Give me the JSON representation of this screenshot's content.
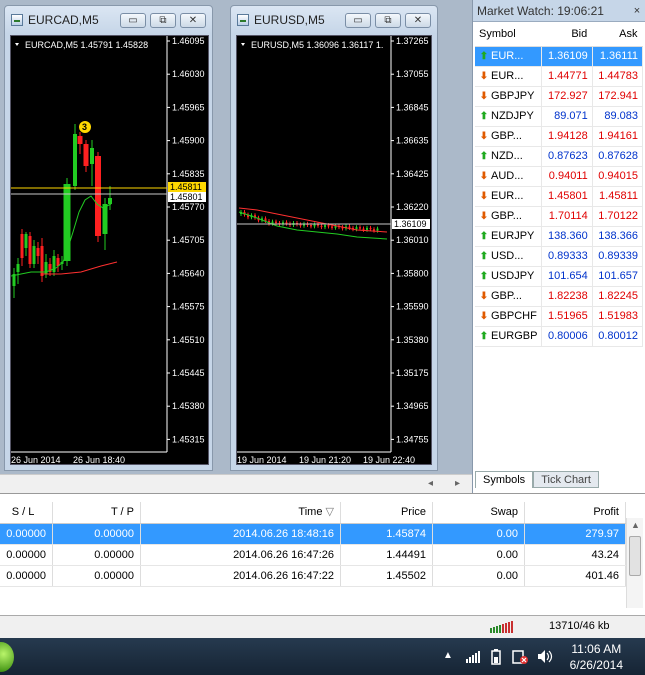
{
  "windows": [
    {
      "title": "EURCAD,M5",
      "chart_header": "EURCAD,M5  1.45791 1.45828",
      "price_labels": [
        "1.46095",
        "1.46030",
        "1.45965",
        "1.45900",
        "1.45835",
        "1.45770",
        "1.45705",
        "1.45640",
        "1.45575",
        "1.45510",
        "1.45445",
        "1.45380",
        "1.45315"
      ],
      "highlight_price": "1.45811",
      "bid_price": "1.45801",
      "time_labels": [
        "26 Jun 2014",
        "26 Jun 18:40"
      ],
      "marker": "3"
    },
    {
      "title": "EURUSD,M5",
      "chart_header": "EURUSD,M5  1.36096 1.36117 1.",
      "price_labels": [
        "1.37265",
        "1.37055",
        "1.36845",
        "1.36635",
        "1.36425",
        "1.36220",
        "1.36010",
        "1.35800",
        "1.35590",
        "1.35380",
        "1.35175",
        "1.34965",
        "1.34755"
      ],
      "bid_price": "1.36109",
      "time_labels": [
        "19 Jun 2014",
        "19 Jun 21:20",
        "19 Jun 22:40"
      ]
    }
  ],
  "window_buttons": {
    "minimize": "▭",
    "restore": "⧉",
    "close": "✕"
  },
  "market_watch": {
    "title": "Market Watch: 19:06:21",
    "close": "×",
    "columns": {
      "symbol": "Symbol",
      "bid": "Bid",
      "ask": "Ask"
    },
    "rows": [
      {
        "symbol": "EUR...",
        "bid": "1.36109",
        "ask": "1.36111",
        "dir": "up",
        "color": "blue",
        "selected": true
      },
      {
        "symbol": "EUR...",
        "bid": "1.44771",
        "ask": "1.44783",
        "dir": "down",
        "color": "red"
      },
      {
        "symbol": "GBPJPY",
        "bid": "172.927",
        "ask": "172.941",
        "dir": "down",
        "color": "red"
      },
      {
        "symbol": "NZDJPY",
        "bid": "89.071",
        "ask": "89.083",
        "dir": "up",
        "color": "blue"
      },
      {
        "symbol": "GBP...",
        "bid": "1.94128",
        "ask": "1.94161",
        "dir": "down",
        "color": "red"
      },
      {
        "symbol": "NZD...",
        "bid": "0.87623",
        "ask": "0.87628",
        "dir": "up",
        "color": "blue"
      },
      {
        "symbol": "AUD...",
        "bid": "0.94011",
        "ask": "0.94015",
        "dir": "down",
        "color": "red"
      },
      {
        "symbol": "EUR...",
        "bid": "1.45801",
        "ask": "1.45811",
        "dir": "down",
        "color": "red"
      },
      {
        "symbol": "GBP...",
        "bid": "1.70114",
        "ask": "1.70122",
        "dir": "down",
        "color": "red"
      },
      {
        "symbol": "EURJPY",
        "bid": "138.360",
        "ask": "138.366",
        "dir": "up",
        "color": "blue"
      },
      {
        "symbol": "USD...",
        "bid": "0.89333",
        "ask": "0.89339",
        "dir": "up",
        "color": "blue"
      },
      {
        "symbol": "USDJPY",
        "bid": "101.654",
        "ask": "101.657",
        "dir": "up",
        "color": "blue"
      },
      {
        "symbol": "GBP...",
        "bid": "1.82238",
        "ask": "1.82245",
        "dir": "down",
        "color": "red"
      },
      {
        "symbol": "GBPCHF",
        "bid": "1.51965",
        "ask": "1.51983",
        "dir": "down",
        "color": "red"
      },
      {
        "symbol": "EURGBP",
        "bid": "0.80006",
        "ask": "0.80012",
        "dir": "up",
        "color": "blue"
      }
    ],
    "tabs": [
      "Symbols",
      "Tick Chart"
    ]
  },
  "terminal": {
    "columns": {
      "sl": "S / L",
      "tp": "T / P",
      "time": "Time",
      "price": "Price",
      "swap": "Swap",
      "profit": "Profit"
    },
    "sort_indicator": "▽",
    "rows": [
      {
        "sl": "0.00000",
        "tp": "0.00000",
        "time": "2014.06.26 18:48:16",
        "price": "1.45874",
        "swap": "0.00",
        "profit": "279.97",
        "selected": true
      },
      {
        "sl": "0.00000",
        "tp": "0.00000",
        "time": "2014.06.26 16:47:26",
        "price": "1.44491",
        "swap": "0.00",
        "profit": "43.24"
      },
      {
        "sl": "0.00000",
        "tp": "0.00000",
        "time": "2014.06.26 16:47:22",
        "price": "1.45502",
        "swap": "0.00",
        "profit": "401.46"
      }
    ]
  },
  "status_bar": {
    "traffic": "13710/46 kb"
  },
  "taskbar": {
    "time": "11:06 AM",
    "date": "6/26/2014"
  },
  "colors": {
    "selection": "#3399ff",
    "bid_up": "#0033cc",
    "bid_down": "#e00000",
    "bull_candle": "#22cc22",
    "bear_candle": "#ff2020"
  }
}
